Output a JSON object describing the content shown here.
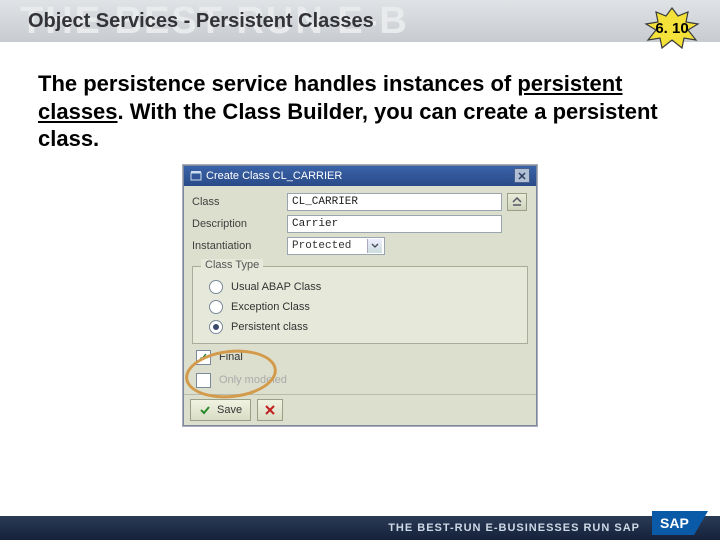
{
  "header": {
    "watermark": "THE BEST-RUN E-B",
    "title": "Object Services - Persistent Classes",
    "badge": "6. 10"
  },
  "body": {
    "line1": "The persistence service handles instances of ",
    "hl": "persistent classes",
    "line2": ". With the Class Builder, you can create a persistent class."
  },
  "dialog": {
    "title": "Create Class CL_CARRIER",
    "class_label": "Class",
    "class_value": "CL_CARRIER",
    "desc_label": "Description",
    "desc_value": "Carrier",
    "inst_label": "Instantiation",
    "inst_value": "Protected",
    "panel_title": "Class Type",
    "options": [
      {
        "label": "Usual ABAP Class",
        "checked": false
      },
      {
        "label": "Exception Class",
        "checked": false
      },
      {
        "label": "Persistent class",
        "checked": true
      }
    ],
    "final_label": "Final",
    "final_checked": true,
    "only_modeled_label": "Only modeled",
    "only_modeled_checked": false,
    "save_label": "Save"
  },
  "footer": {
    "text": "THE BEST-RUN E-BUSINESSES RUN SAP"
  }
}
